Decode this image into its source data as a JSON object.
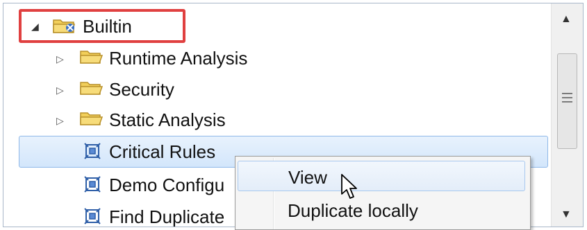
{
  "tree": {
    "items": [
      {
        "label": "Builtin",
        "icon": "config-folder-icon",
        "twisty": "expanded"
      },
      {
        "label": "Runtime Analysis",
        "icon": "folder-icon",
        "twisty": "collapsed"
      },
      {
        "label": "Security",
        "icon": "folder-icon",
        "twisty": "collapsed"
      },
      {
        "label": "Static Analysis",
        "icon": "folder-icon",
        "twisty": "collapsed"
      },
      {
        "label": "Critical Rules",
        "icon": "test-config-icon",
        "selected": true
      },
      {
        "label": "Demo Configu",
        "icon": "test-config-icon"
      },
      {
        "label": "Find Duplicate",
        "icon": "test-config-icon"
      }
    ],
    "twisty_expanded": "◢",
    "twisty_collapsed": "▷"
  },
  "context_menu": {
    "items": [
      {
        "label": "View"
      },
      {
        "label": "Duplicate locally"
      }
    ]
  },
  "scrollbar": {
    "up_arrow": "▲",
    "down_arrow": "▼"
  },
  "colors": {
    "highlight_box": "#e04040",
    "selection": "#d3e6fb",
    "folder": "#f0c84a"
  }
}
